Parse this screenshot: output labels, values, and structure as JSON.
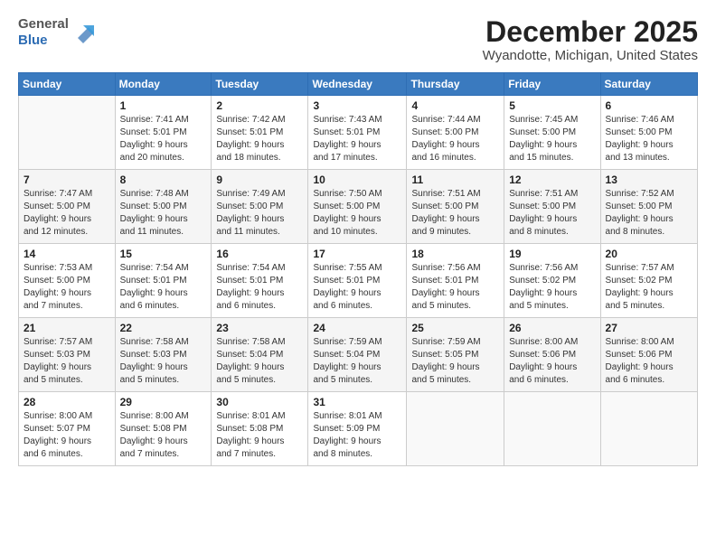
{
  "header": {
    "logo_line1": "General",
    "logo_line2": "Blue",
    "month_title": "December 2025",
    "location": "Wyandotte, Michigan, United States"
  },
  "days_of_week": [
    "Sunday",
    "Monday",
    "Tuesday",
    "Wednesday",
    "Thursday",
    "Friday",
    "Saturday"
  ],
  "weeks": [
    [
      {
        "day": "",
        "content": ""
      },
      {
        "day": "1",
        "content": "Sunrise: 7:41 AM\nSunset: 5:01 PM\nDaylight: 9 hours\nand 20 minutes."
      },
      {
        "day": "2",
        "content": "Sunrise: 7:42 AM\nSunset: 5:01 PM\nDaylight: 9 hours\nand 18 minutes."
      },
      {
        "day": "3",
        "content": "Sunrise: 7:43 AM\nSunset: 5:01 PM\nDaylight: 9 hours\nand 17 minutes."
      },
      {
        "day": "4",
        "content": "Sunrise: 7:44 AM\nSunset: 5:00 PM\nDaylight: 9 hours\nand 16 minutes."
      },
      {
        "day": "5",
        "content": "Sunrise: 7:45 AM\nSunset: 5:00 PM\nDaylight: 9 hours\nand 15 minutes."
      },
      {
        "day": "6",
        "content": "Sunrise: 7:46 AM\nSunset: 5:00 PM\nDaylight: 9 hours\nand 13 minutes."
      }
    ],
    [
      {
        "day": "7",
        "content": "Sunrise: 7:47 AM\nSunset: 5:00 PM\nDaylight: 9 hours\nand 12 minutes."
      },
      {
        "day": "8",
        "content": "Sunrise: 7:48 AM\nSunset: 5:00 PM\nDaylight: 9 hours\nand 11 minutes."
      },
      {
        "day": "9",
        "content": "Sunrise: 7:49 AM\nSunset: 5:00 PM\nDaylight: 9 hours\nand 11 minutes."
      },
      {
        "day": "10",
        "content": "Sunrise: 7:50 AM\nSunset: 5:00 PM\nDaylight: 9 hours\nand 10 minutes."
      },
      {
        "day": "11",
        "content": "Sunrise: 7:51 AM\nSunset: 5:00 PM\nDaylight: 9 hours\nand 9 minutes."
      },
      {
        "day": "12",
        "content": "Sunrise: 7:51 AM\nSunset: 5:00 PM\nDaylight: 9 hours\nand 8 minutes."
      },
      {
        "day": "13",
        "content": "Sunrise: 7:52 AM\nSunset: 5:00 PM\nDaylight: 9 hours\nand 8 minutes."
      }
    ],
    [
      {
        "day": "14",
        "content": "Sunrise: 7:53 AM\nSunset: 5:00 PM\nDaylight: 9 hours\nand 7 minutes."
      },
      {
        "day": "15",
        "content": "Sunrise: 7:54 AM\nSunset: 5:01 PM\nDaylight: 9 hours\nand 6 minutes."
      },
      {
        "day": "16",
        "content": "Sunrise: 7:54 AM\nSunset: 5:01 PM\nDaylight: 9 hours\nand 6 minutes."
      },
      {
        "day": "17",
        "content": "Sunrise: 7:55 AM\nSunset: 5:01 PM\nDaylight: 9 hours\nand 6 minutes."
      },
      {
        "day": "18",
        "content": "Sunrise: 7:56 AM\nSunset: 5:01 PM\nDaylight: 9 hours\nand 5 minutes."
      },
      {
        "day": "19",
        "content": "Sunrise: 7:56 AM\nSunset: 5:02 PM\nDaylight: 9 hours\nand 5 minutes."
      },
      {
        "day": "20",
        "content": "Sunrise: 7:57 AM\nSunset: 5:02 PM\nDaylight: 9 hours\nand 5 minutes."
      }
    ],
    [
      {
        "day": "21",
        "content": "Sunrise: 7:57 AM\nSunset: 5:03 PM\nDaylight: 9 hours\nand 5 minutes."
      },
      {
        "day": "22",
        "content": "Sunrise: 7:58 AM\nSunset: 5:03 PM\nDaylight: 9 hours\nand 5 minutes."
      },
      {
        "day": "23",
        "content": "Sunrise: 7:58 AM\nSunset: 5:04 PM\nDaylight: 9 hours\nand 5 minutes."
      },
      {
        "day": "24",
        "content": "Sunrise: 7:59 AM\nSunset: 5:04 PM\nDaylight: 9 hours\nand 5 minutes."
      },
      {
        "day": "25",
        "content": "Sunrise: 7:59 AM\nSunset: 5:05 PM\nDaylight: 9 hours\nand 5 minutes."
      },
      {
        "day": "26",
        "content": "Sunrise: 8:00 AM\nSunset: 5:06 PM\nDaylight: 9 hours\nand 6 minutes."
      },
      {
        "day": "27",
        "content": "Sunrise: 8:00 AM\nSunset: 5:06 PM\nDaylight: 9 hours\nand 6 minutes."
      }
    ],
    [
      {
        "day": "28",
        "content": "Sunrise: 8:00 AM\nSunset: 5:07 PM\nDaylight: 9 hours\nand 6 minutes."
      },
      {
        "day": "29",
        "content": "Sunrise: 8:00 AM\nSunset: 5:08 PM\nDaylight: 9 hours\nand 7 minutes."
      },
      {
        "day": "30",
        "content": "Sunrise: 8:01 AM\nSunset: 5:08 PM\nDaylight: 9 hours\nand 7 minutes."
      },
      {
        "day": "31",
        "content": "Sunrise: 8:01 AM\nSunset: 5:09 PM\nDaylight: 9 hours\nand 8 minutes."
      },
      {
        "day": "",
        "content": ""
      },
      {
        "day": "",
        "content": ""
      },
      {
        "day": "",
        "content": ""
      }
    ]
  ]
}
